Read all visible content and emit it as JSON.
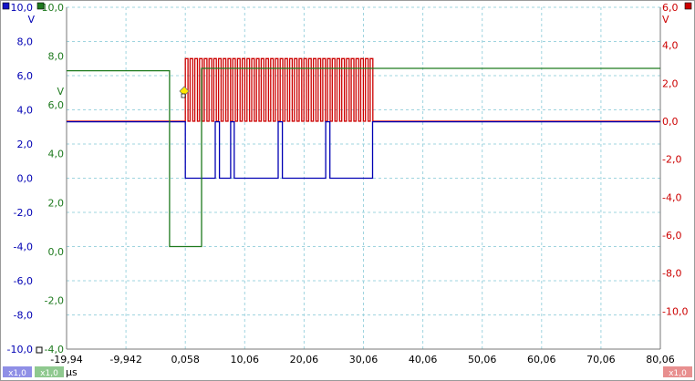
{
  "chart_data": {
    "type": "line",
    "x_unit": "µs",
    "x_ticks": [
      "-19,94",
      "-9,942",
      "0,058",
      "10,06",
      "20,06",
      "30,06",
      "40,06",
      "50,06",
      "60,06",
      "70,06",
      "80,06"
    ],
    "xlim": [
      -19.94,
      80.06
    ],
    "axes": {
      "blue": {
        "unit": "V",
        "ticks": [
          "10,0",
          "8,0",
          "6,0",
          "4,0",
          "2,0",
          "0,0",
          "-2,0",
          "-4,0",
          "-6,0",
          "-8,0",
          "-10,0"
        ],
        "ylim": [
          -10,
          10
        ]
      },
      "green": {
        "unit": "V",
        "ticks": [
          "10,0",
          "8,0",
          "6,0",
          "4,0",
          "2,0",
          "0,0",
          "-2,0",
          "-4,0"
        ],
        "ylim": [
          -4,
          10
        ]
      },
      "red": {
        "unit": "V",
        "ticks": [
          "6,0",
          "4,0",
          "2,0",
          "0,0",
          "-2,0",
          "-4,0",
          "-6,0",
          "-8,0",
          "-10,0"
        ],
        "ylim": [
          -12,
          6
        ]
      }
    },
    "series": [
      {
        "color": "#cc0000",
        "axis": "red",
        "kind": "burst",
        "baseline": 0.0,
        "high": 3.3,
        "x_start": 0.06,
        "x_end": 32.0,
        "n_pulses": 40,
        "x_min": -19.94,
        "x_max": 80.06
      },
      {
        "color": "#0000b4",
        "axis": "blue",
        "kind": "steps",
        "high": 3.3,
        "low": 0.0,
        "segments": [
          [
            -19.94,
            3.3
          ],
          [
            0.06,
            0.0
          ],
          [
            5.1,
            3.3
          ],
          [
            5.8,
            0.0
          ],
          [
            7.7,
            3.3
          ],
          [
            8.3,
            0.0
          ],
          [
            15.7,
            3.3
          ],
          [
            16.4,
            0.0
          ],
          [
            23.7,
            3.3
          ],
          [
            24.4,
            0.0
          ],
          [
            31.6,
            3.3
          ],
          [
            80.06,
            3.3
          ]
        ]
      },
      {
        "color": "#1e7a1e",
        "axis": "green",
        "kind": "steps",
        "segments": [
          [
            -19.94,
            7.4
          ],
          [
            -2.6,
            0.2
          ],
          [
            2.8,
            7.5
          ],
          [
            80.06,
            7.5
          ]
        ]
      }
    ]
  },
  "badges": {
    "x_blue": "x1,0",
    "x_green": "x1,0",
    "x_red": "x1,0"
  },
  "colors": {
    "blue": "#0000b4",
    "green": "#1e7a1e",
    "red": "#cc0000",
    "grid": "#9fd4df"
  }
}
